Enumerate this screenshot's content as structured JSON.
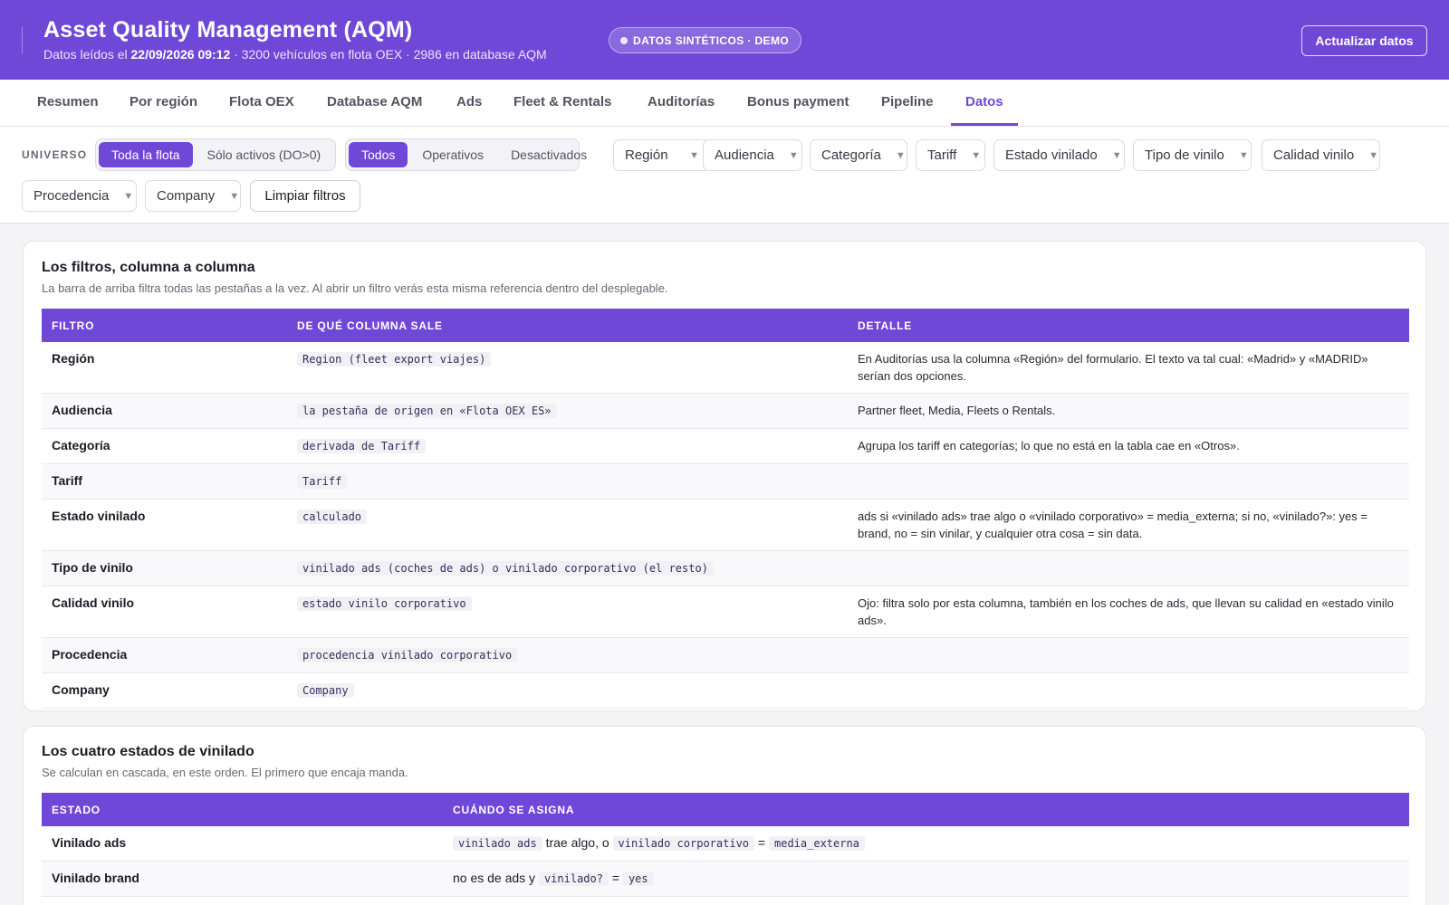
{
  "header": {
    "title": "Asset Quality Management (AQM)",
    "subtitle_prefix": "Datos leídos el",
    "read_date": "22/09/2026 09:12",
    "subtitle_suffix": "· 3200 vehículos en flota OEX · 2986 en database AQM",
    "badge": "DATOS SINTÉTICOS · DEMO",
    "refresh_label": "Actualizar datos"
  },
  "tabs": [
    "Resumen",
    "Por región",
    "Flota OEX",
    "Database AQM",
    "Ads",
    "Fleet & Rentals",
    "Auditorías",
    "Bonus payment",
    "Pipeline",
    "Datos"
  ],
  "active_tab": "Datos",
  "filters": {
    "universe_label": "UNIVERSO",
    "scope_options": [
      "Toda la flota",
      "Sólo activos (DO>0)"
    ],
    "scope_selected": "Toda la flota",
    "status_options": [
      "Todos",
      "Operativos",
      "Desactivados"
    ],
    "status_selected": "Todos",
    "dropdowns": [
      "Región",
      "Audiencia",
      "Categoría",
      "Tariff",
      "Estado vinilado",
      "Tipo de vinilo",
      "Calidad vinilo",
      "Procedencia",
      "Company"
    ],
    "clear_label": "Limpiar filtros"
  },
  "filters_card": {
    "title": "Los filtros, columna a columna",
    "description": "La barra de arriba filtra todas las pestañas a la vez. Al abrir un filtro verás esta misma referencia dentro del desplegable.",
    "columns": [
      "FILTRO",
      "DE QUÉ COLUMNA SALE",
      "DETALLE"
    ],
    "rows": [
      {
        "filter": "Región",
        "source": "Region (fleet export viajes)",
        "detail": "En Auditorías usa la columna «Región» del formulario. El texto va tal cual: «Madrid» y «MADRID» serían dos opciones."
      },
      {
        "filter": "Audiencia",
        "source": "la pestaña de origen en «Flota OEX ES»",
        "detail": "Partner fleet, Media, Fleets o Rentals."
      },
      {
        "filter": "Categoría",
        "source": "derivada de Tariff",
        "detail": "Agrupa los tariff en categorías; lo que no está en la tabla cae en «Otros»."
      },
      {
        "filter": "Tariff",
        "source": "Tariff",
        "detail": ""
      },
      {
        "filter": "Estado vinilado",
        "source": "calculado",
        "detail": "ads si «vinilado ads» trae algo o «vinilado corporativo» = media_externa; si no, «vinilado?»: yes = brand, no = sin vinilar, y cualquier otra cosa = sin data."
      },
      {
        "filter": "Tipo de vinilo",
        "source": "vinilado ads (coches de ads) o vinilado corporativo (el resto)",
        "detail": ""
      },
      {
        "filter": "Calidad vinilo",
        "source": "estado vinilo corporativo",
        "detail": "Ojo: filtra solo por esta columna, también en los coches de ads, que llevan su calidad en «estado vinilo ads»."
      },
      {
        "filter": "Procedencia",
        "source": "procedencia vinilado corporativo",
        "detail": ""
      },
      {
        "filter": "Company",
        "source": "Company",
        "detail": ""
      }
    ]
  },
  "states_card": {
    "title": "Los cuatro estados de vinilado",
    "description": "Se calculan en cascada, en este orden. El primero que encaja manda.",
    "columns": [
      "ESTADO",
      "CUÁNDO SE ASIGNA"
    ],
    "rows": [
      {
        "state": "Vinilado ads",
        "parts": [
          {
            "code": "vinilado ads"
          },
          {
            "text": " trae algo, o "
          },
          {
            "code": "vinilado corporativo"
          },
          {
            "text": " = "
          },
          {
            "code": "media_externa"
          }
        ]
      },
      {
        "state": "Vinilado brand",
        "parts": [
          {
            "text": "no es de ads y "
          },
          {
            "code": "vinilado?"
          },
          {
            "text": " = "
          },
          {
            "code": "yes"
          }
        ]
      }
    ]
  }
}
